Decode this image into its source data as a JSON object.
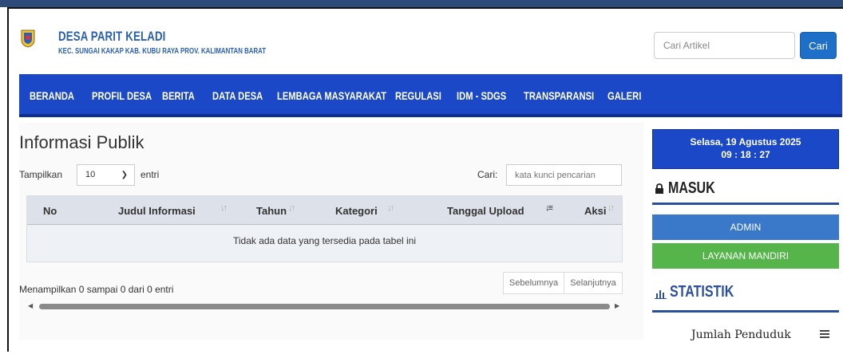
{
  "header": {
    "title": "DESA PARIT KELADI",
    "subtitle": "KEC. SUNGAI KAKAP KAB. KUBU RAYA PROV. KALIMANTAN BARAT",
    "search_placeholder": "Cari Artikel",
    "search_button": "Cari"
  },
  "nav": {
    "items": [
      "BERANDA",
      "PROFIL DESA",
      "BERITA",
      "DATA DESA",
      "LEMBAGA MASYARAKAT",
      "REGULASI",
      "IDM - SDGS",
      "TRANSPARANSI",
      "GALERI"
    ]
  },
  "main": {
    "title": "Informasi Publik",
    "show_label": "Tampilkan",
    "show_value": "10",
    "entries_label": "entri",
    "search_label": "Cari:",
    "search_placeholder": "kata kunci pencarian",
    "columns": [
      "No",
      "Judul Informasi",
      "Tahun",
      "Kategori",
      "Tanggal Upload",
      "Aksi"
    ],
    "empty_message": "Tidak ada data yang tersedia pada tabel ini",
    "info": "Menampilkan 0 sampai 0 dari 0 entri",
    "prev": "Sebelumnya",
    "next": "Selanjutnya"
  },
  "sidebar": {
    "date": "Selasa, 19 Agustus 2025",
    "time": "09 : 18 : 27",
    "login_title": "MASUK",
    "admin_button": "ADMIN",
    "layanan_button": "LAYANAN MANDIRI",
    "stats_title": "STATISTIK",
    "population_title": "Jumlah Penduduk"
  },
  "colors": {
    "nav_bg": "#1a48c7",
    "title_blue": "#2a5fb0",
    "admin_btn": "#3a78c9",
    "layanan_btn": "#55b54a"
  }
}
